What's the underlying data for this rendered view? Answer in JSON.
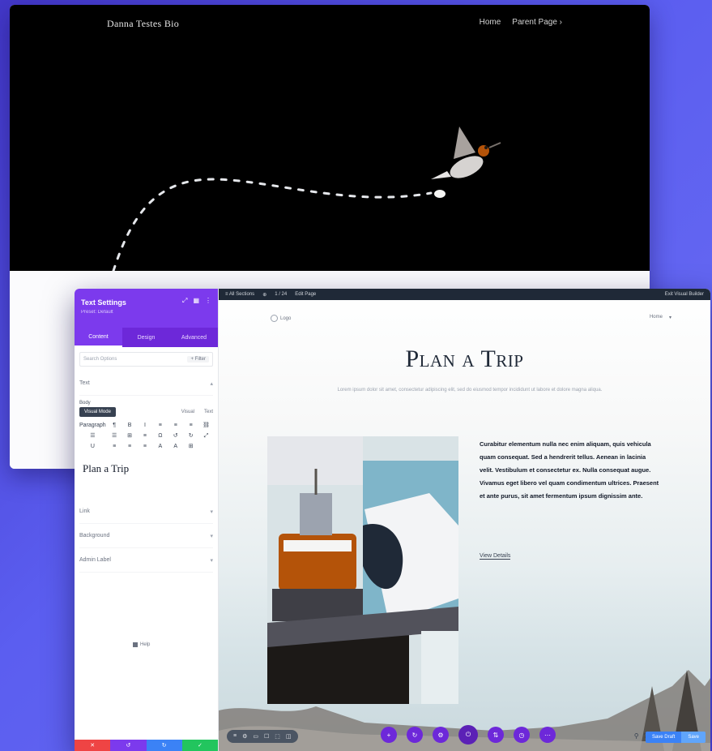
{
  "back_window": {
    "brand": "Danna Testes Bio",
    "nav": [
      "Home",
      "Parent Page ›"
    ]
  },
  "settings_panel": {
    "title": "Text Settings",
    "subtitle": "Preset: Default",
    "tabs": [
      "Content",
      "Design",
      "Advanced"
    ],
    "active_tab": "Content",
    "search_placeholder": "Search Options",
    "filter_label": "+ Filter",
    "section_text": "Text",
    "body_label": "Body",
    "visual_button": "Visual Mode",
    "editor_tabs": [
      "Visual",
      "Text"
    ],
    "format_row1": [
      "Paragraph",
      "¶",
      "B",
      "I",
      "≡",
      "≡",
      "≡",
      "⛓"
    ],
    "format_row2": [
      "☰",
      "☰",
      "⊞",
      "≡",
      "Ω",
      "↺",
      "↻",
      "⤢"
    ],
    "format_row3": [
      "U",
      "≡",
      "≡",
      "≡",
      "A",
      "A",
      "⊞",
      " "
    ],
    "preview_text": "Plan a Trip",
    "section_link": "Link",
    "section_background": "Background",
    "section_admin": "Admin Label",
    "help_label": "Help",
    "bottom_buttons": [
      "✕",
      "↺",
      "↻",
      "✓"
    ],
    "bottom_colors": [
      "#ef4444",
      "#7c3aed",
      "#3b82f6",
      "#22c55e"
    ]
  },
  "canvas": {
    "topbar": [
      "≡ All Sections",
      "⊕",
      "1 / 24",
      "Edit Page",
      "Exit Visual Builder"
    ],
    "topbar_right": "Exit Visual Builder",
    "site_logo": "Logo",
    "site_nav": [
      "Home",
      "▾"
    ],
    "heading": "Plan a Trip",
    "intro_text": "Lorem ipsum dolor sit amet, consectetur adipiscing elit, sed do eiusmod tempor incididunt ut labore et dolore magna aliqua.",
    "description": "Curabitur elementum nulla nec enim aliquam, quis vehicula quam consequat. Sed a hendrerit tellus. Aenean in lacinia velit. Vestibulum et consectetur ex. Nulla consequat augue. Vivamus eget libero vel quam condimentum ultrices. Praesent et ante purus, sit amet fermentum ipsum dignissim ante.",
    "read_more": "View Details",
    "bottom_left_tools": [
      "≡",
      "⚙",
      "▭",
      "☐",
      "⬚",
      "◫"
    ],
    "circle_buttons": [
      "+",
      "↻",
      "⚙",
      "⏻",
      "⇅",
      "◷",
      "⋯"
    ],
    "right_tools": [
      "⚲",
      "?"
    ],
    "save_draft": "Save Draft",
    "save": "Save"
  },
  "colors": {
    "background": "#5b5ef0",
    "accent": "#7c3aed",
    "primary_button": "#3b82f6"
  }
}
